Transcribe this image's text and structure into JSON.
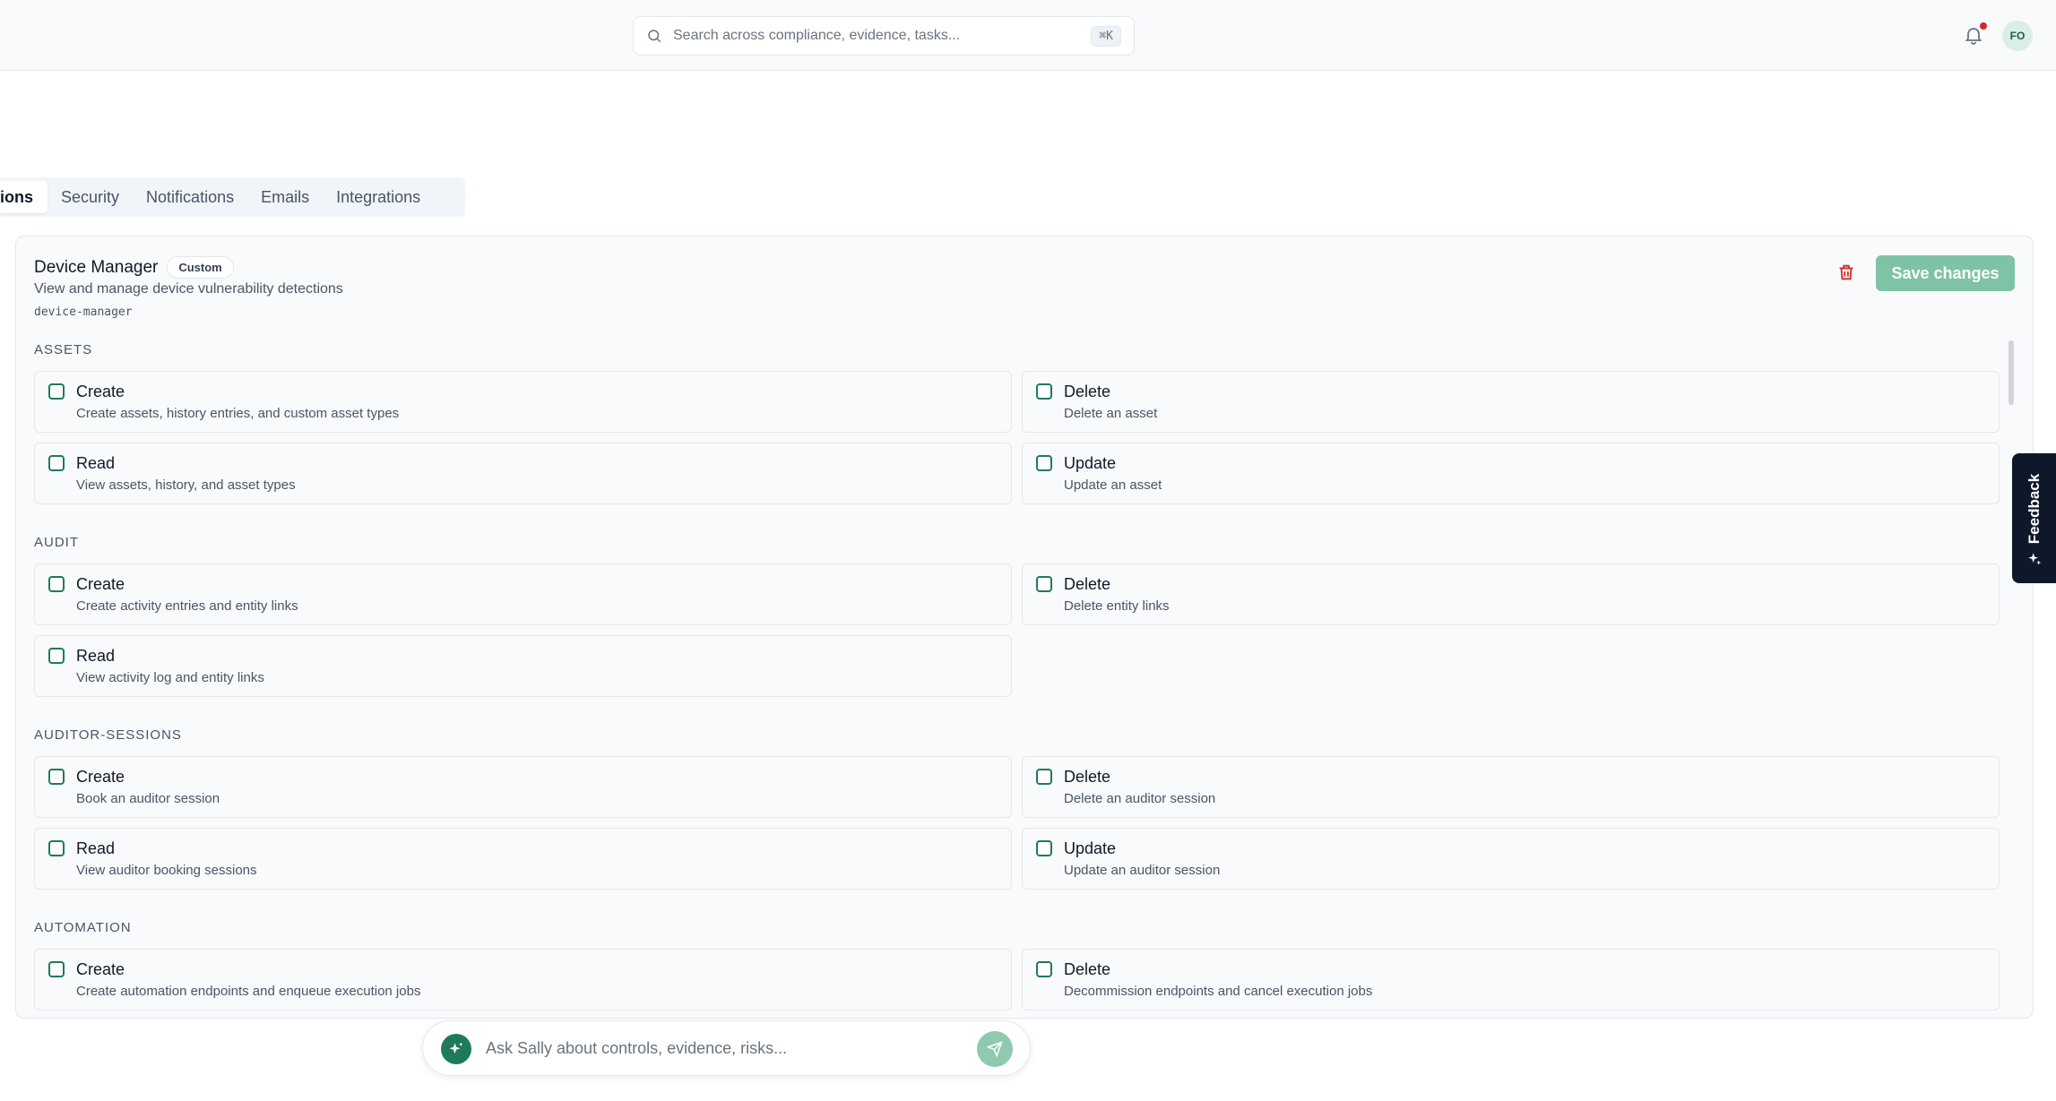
{
  "header": {
    "search_placeholder": "Search across compliance, evidence, tasks...",
    "search_shortcut": "⌘K",
    "avatar_initials": "FO"
  },
  "tabs": [
    {
      "label": "ions",
      "active": true
    },
    {
      "label": "Security",
      "active": false
    },
    {
      "label": "Notifications",
      "active": false
    },
    {
      "label": "Emails",
      "active": false
    },
    {
      "label": "Integrations",
      "active": false
    }
  ],
  "role": {
    "name": "Device Manager",
    "badge": "Custom",
    "description": "View and manage device vulnerability detections",
    "slug": "device-manager",
    "save_label": "Save changes"
  },
  "sections": [
    {
      "label": "ASSETS",
      "permissions": [
        {
          "name": "Create",
          "description": "Create assets, history entries, and custom asset types"
        },
        {
          "name": "Delete",
          "description": "Delete an asset"
        },
        {
          "name": "Read",
          "description": "View assets, history, and asset types"
        },
        {
          "name": "Update",
          "description": "Update an asset"
        }
      ]
    },
    {
      "label": "AUDIT",
      "permissions": [
        {
          "name": "Create",
          "description": "Create activity entries and entity links"
        },
        {
          "name": "Delete",
          "description": "Delete entity links"
        },
        {
          "name": "Read",
          "description": "View activity log and entity links"
        }
      ]
    },
    {
      "label": "AUDITOR-SESSIONS",
      "permissions": [
        {
          "name": "Create",
          "description": "Book an auditor session"
        },
        {
          "name": "Delete",
          "description": "Delete an auditor session"
        },
        {
          "name": "Read",
          "description": "View auditor booking sessions"
        },
        {
          "name": "Update",
          "description": "Update an auditor session"
        }
      ]
    },
    {
      "label": "AUTOMATION",
      "permissions": [
        {
          "name": "Create",
          "description": "Create automation endpoints and enqueue execution jobs"
        },
        {
          "name": "Delete",
          "description": "Decommission endpoints and cancel execution jobs"
        }
      ]
    }
  ],
  "feedback": {
    "label": "Feedback"
  },
  "assistant": {
    "placeholder": "Ask Sally about controls, evidence, risks..."
  },
  "colors": {
    "accent": "#1f7a5c",
    "save_button": "#7fc3a6",
    "danger": "#dc2626",
    "feedback_bg": "#0f172a"
  }
}
